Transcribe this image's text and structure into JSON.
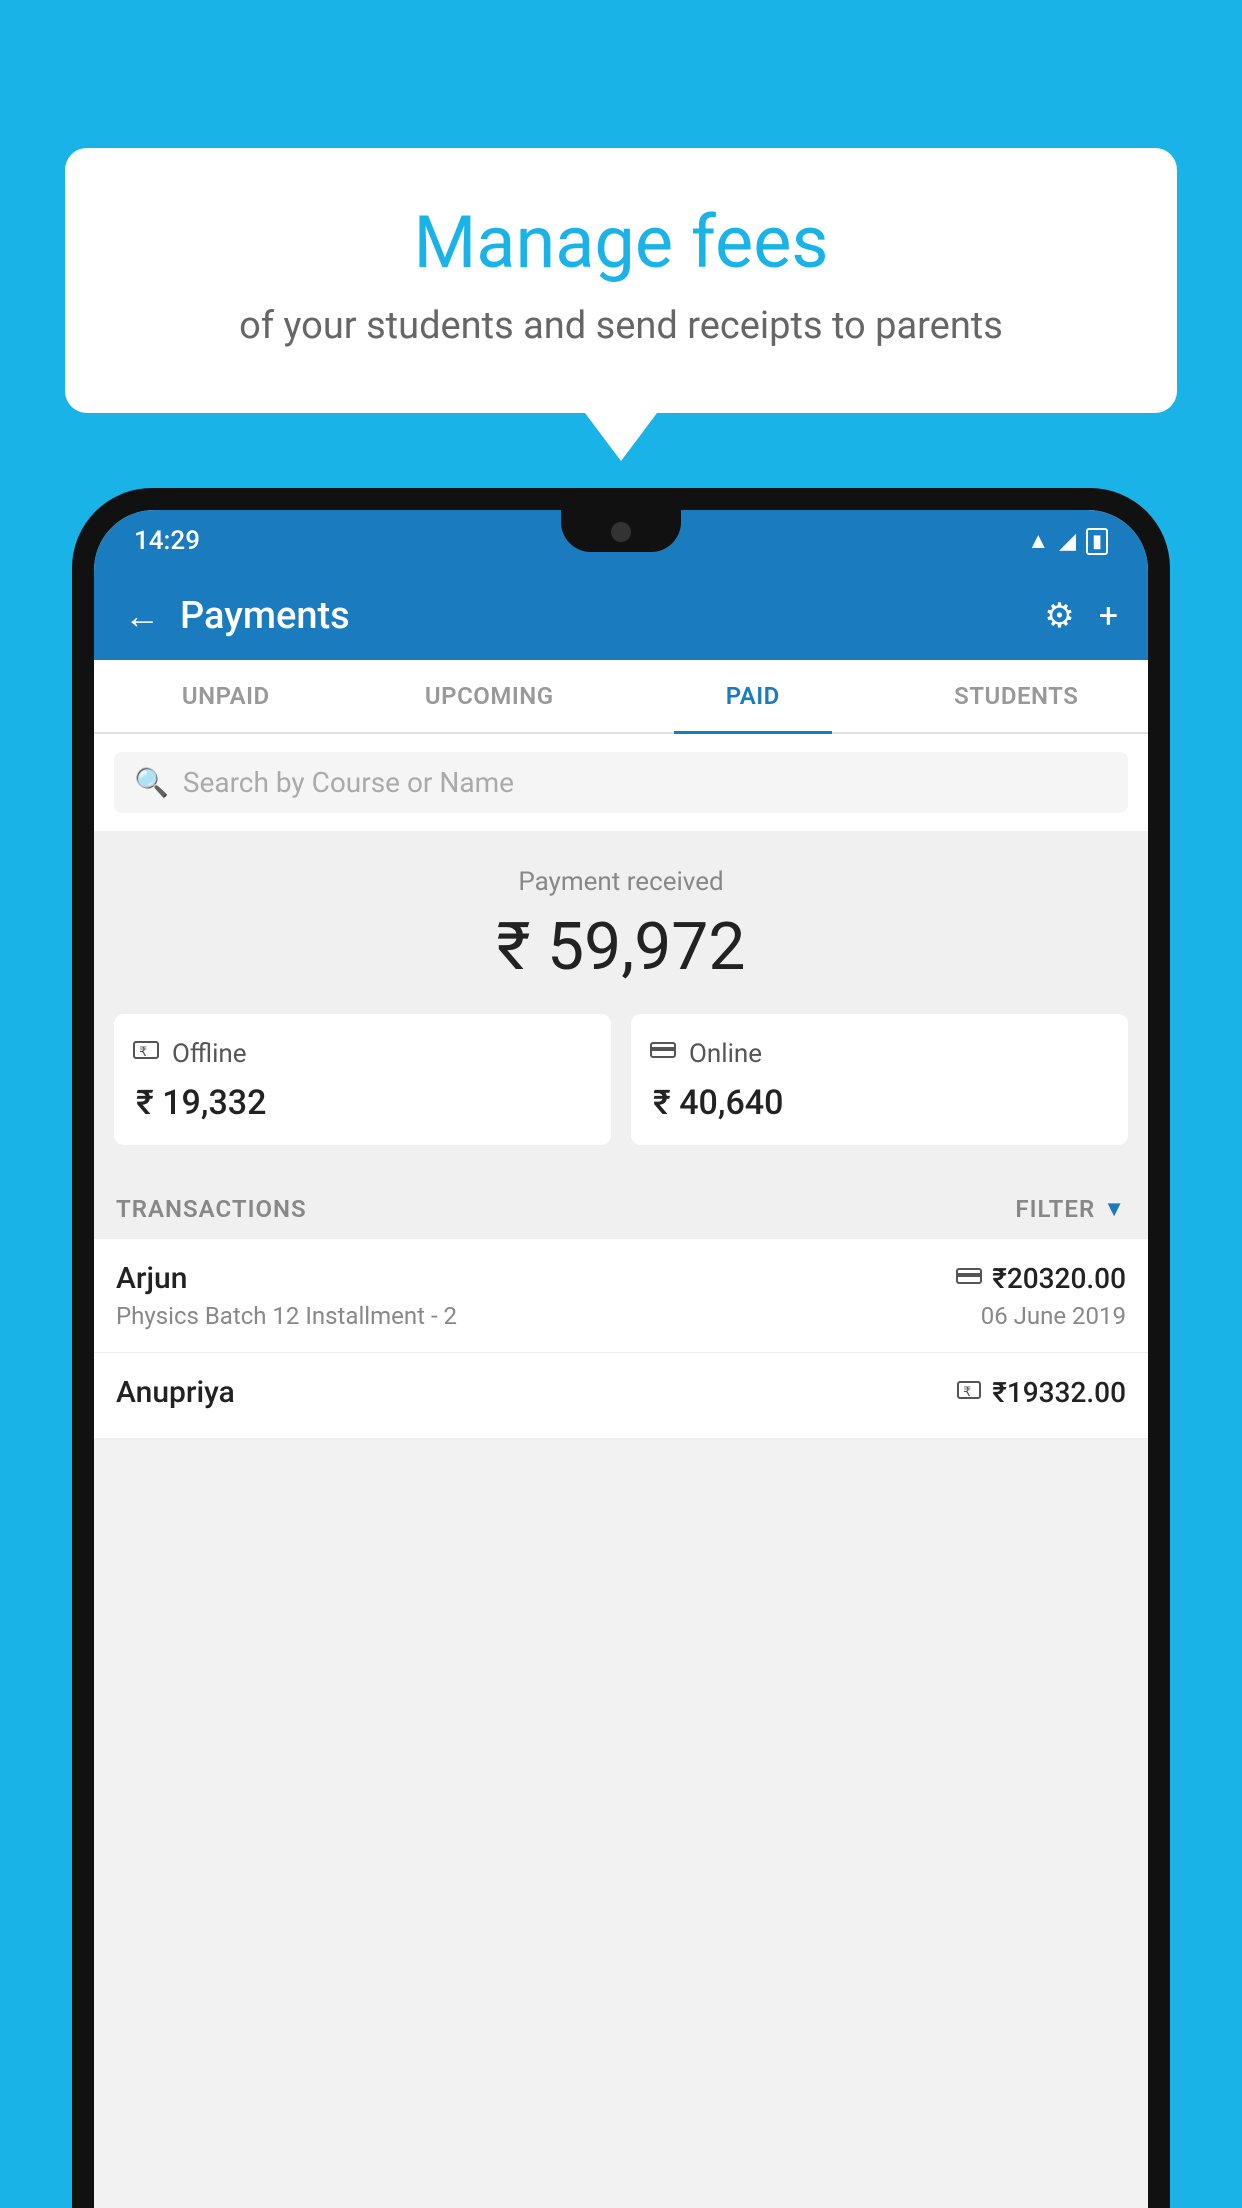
{
  "background_color": "#1ab3e8",
  "hero": {
    "title": "Manage fees",
    "subtitle": "of your students and send receipts to parents"
  },
  "status_bar": {
    "time": "14:29",
    "wifi_icon": "▲",
    "signal_icon": "▲",
    "battery_icon": "▮"
  },
  "app_bar": {
    "back_label": "←",
    "title": "Payments",
    "settings_icon": "⚙",
    "add_icon": "+"
  },
  "tabs": [
    {
      "label": "UNPAID",
      "active": false
    },
    {
      "label": "UPCOMING",
      "active": false
    },
    {
      "label": "PAID",
      "active": true
    },
    {
      "label": "STUDENTS",
      "active": false
    }
  ],
  "search": {
    "placeholder": "Search by Course or Name"
  },
  "payment_summary": {
    "label": "Payment received",
    "amount": "₹ 59,972",
    "offline": {
      "icon": "💳",
      "label": "Offline",
      "amount": "₹ 19,332"
    },
    "online": {
      "icon": "💳",
      "label": "Online",
      "amount": "₹ 40,640"
    }
  },
  "transactions": {
    "header_label": "TRANSACTIONS",
    "filter_label": "FILTER",
    "rows": [
      {
        "name": "Arjun",
        "description": "Physics Batch 12 Installment - 2",
        "amount": "₹20320.00",
        "date": "06 June 2019",
        "type_icon": "💳"
      },
      {
        "name": "Anupriya",
        "description": "",
        "amount": "₹19332.00",
        "date": "",
        "type_icon": "💵"
      }
    ]
  }
}
